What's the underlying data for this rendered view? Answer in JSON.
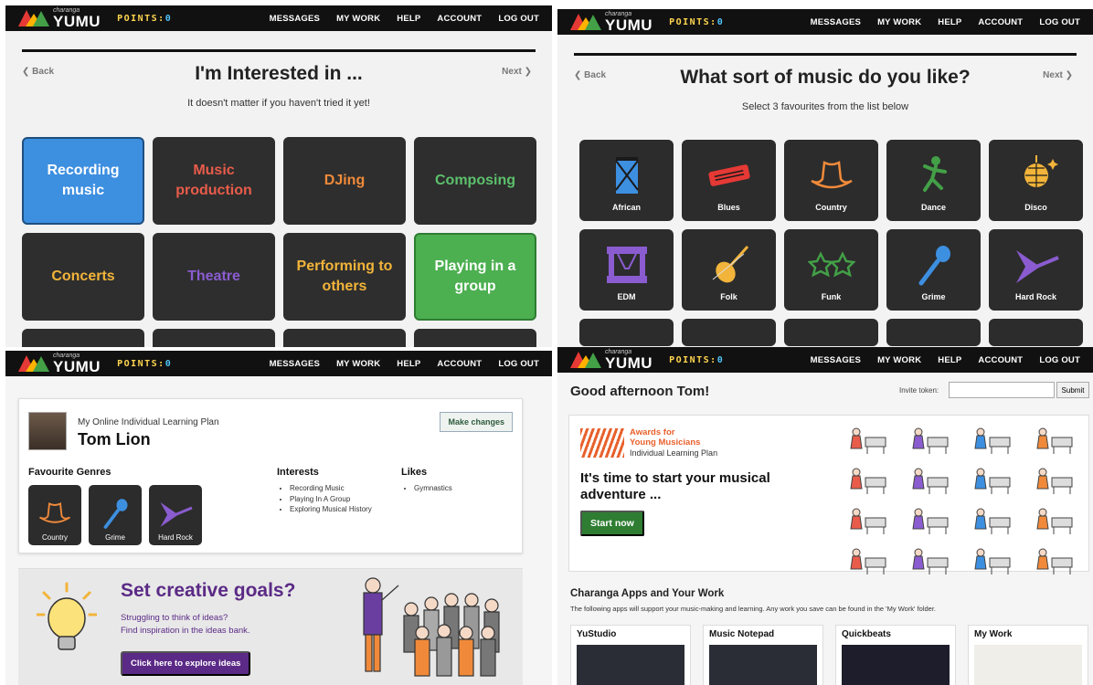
{
  "nav": {
    "logo_small": "charanga",
    "logo_word": "YUMU",
    "points_label": "POINTS:",
    "points_value": "0",
    "menu": [
      "MESSAGES",
      "MY WORK",
      "HELP",
      "ACCOUNT",
      "LOG OUT"
    ]
  },
  "interests_screen": {
    "back": "❮ Back",
    "next": "Next ❯",
    "title": "I'm Interested in ...",
    "subtitle": "It doesn't matter if you haven't tried it yet!",
    "tiles": [
      {
        "label": "Recording music",
        "color": "#ffffff",
        "selected": "blue"
      },
      {
        "label": "Music production",
        "color": "#e85c4a",
        "selected": ""
      },
      {
        "label": "DJing",
        "color": "#f08a3a",
        "selected": ""
      },
      {
        "label": "Composing",
        "color": "#5cc06b",
        "selected": ""
      },
      {
        "label": "Concerts",
        "color": "#f2b43a",
        "selected": ""
      },
      {
        "label": "Theatre",
        "color": "#8a5cd0",
        "selected": ""
      },
      {
        "label": "Performing to others",
        "color": "#f2b43a",
        "selected": ""
      },
      {
        "label": "Playing in a group",
        "color": "#ffffff",
        "selected": "green"
      }
    ]
  },
  "genres_screen": {
    "back": "❮ Back",
    "next": "Next ❯",
    "title": "What sort of music do you like?",
    "subtitle": "Select 3 favourites from the list below",
    "genres": [
      {
        "label": "African",
        "icon": "drum-icon",
        "color": "#3d8fe0"
      },
      {
        "label": "Blues",
        "icon": "harmonica-icon",
        "color": "#e53935"
      },
      {
        "label": "Country",
        "icon": "cowboy-hat-icon",
        "color": "#f08a3a"
      },
      {
        "label": "Dance",
        "icon": "dancer-icon",
        "color": "#43a047"
      },
      {
        "label": "Disco",
        "icon": "disco-ball-icon",
        "color": "#f2b43a"
      },
      {
        "label": "EDM",
        "icon": "stage-icon",
        "color": "#8a5cd0"
      },
      {
        "label": "Folk",
        "icon": "violin-icon",
        "color": "#f2b43a"
      },
      {
        "label": "Funk",
        "icon": "star-glasses-icon",
        "color": "#43a047"
      },
      {
        "label": "Grime",
        "icon": "microphone-icon",
        "color": "#3d8fe0"
      },
      {
        "label": "Hard Rock",
        "icon": "flying-v-guitar-icon",
        "color": "#8a5cd0"
      }
    ]
  },
  "plan_screen": {
    "ilp_label": "My Online Individual Learning Plan",
    "student_name": "Tom Lion",
    "make_changes": "Make changes",
    "favourite_genres_heading": "Favourite Genres",
    "favourites": [
      {
        "label": "Country",
        "icon": "cowboy-hat-icon",
        "color": "#f08a3a"
      },
      {
        "label": "Grime",
        "icon": "microphone-icon",
        "color": "#3d8fe0"
      },
      {
        "label": "Hard Rock",
        "icon": "flying-v-guitar-icon",
        "color": "#8a5cd0"
      }
    ],
    "interests_heading": "Interests",
    "interests": [
      "Recording Music",
      "Playing In A Group",
      "Exploring Musical History"
    ],
    "likes_heading": "Likes",
    "likes": [
      "Gymnastics"
    ],
    "goals_title": "Set creative goals?",
    "goals_line1": "Struggling to think of ideas?",
    "goals_line2": "Find inspiration in the ideas bank.",
    "ideas_button": "Click here to explore ideas"
  },
  "home_screen": {
    "greeting": "Good afternoon Tom!",
    "invite_label": "Invite token:",
    "invite_value": "",
    "submit": "Submit",
    "award_line1": "Awards for",
    "award_line2": "Young Musicians",
    "award_line3": "Individual Learning Plan",
    "promo_heading": "It's time to start your musical adventure ...",
    "start_now": "Start now",
    "apps_heading": "Charanga Apps and Your Work",
    "apps_text": "The following apps will support your music-making and learning. Any work you save can be found in the 'My Work' folder.",
    "apps": [
      "YuStudio",
      "Music Notepad",
      "Quickbeats",
      "My Work"
    ]
  }
}
